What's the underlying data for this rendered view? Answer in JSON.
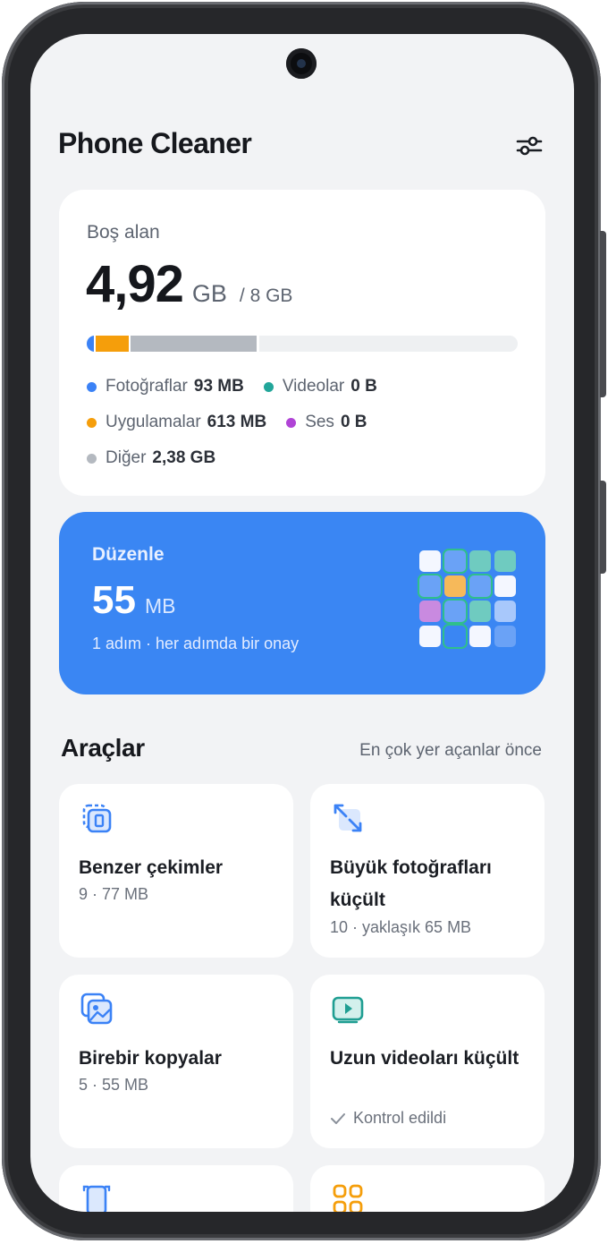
{
  "app": {
    "title": "Phone Cleaner",
    "settings_icon": "sliders-icon"
  },
  "storage": {
    "label": "Boş alan",
    "free_value": "4,92",
    "free_unit": "GB",
    "total": "/ 8 GB",
    "bar_fractions": {
      "photos": 0.012,
      "apps": 0.077,
      "other": 0.298,
      "free": 0.613
    },
    "legend": [
      {
        "label": "Fotoğraflar",
        "value": "93 MB",
        "color": "#3b82f6"
      },
      {
        "label": "Videolar",
        "value": "0 B",
        "color": "#22a69a"
      },
      {
        "label": "Uygulamalar",
        "value": "613 MB",
        "color": "#f59e0b"
      },
      {
        "label": "Ses",
        "value": "0 B",
        "color": "#b044d6"
      },
      {
        "label": "Diğer",
        "value": "2,38 GB",
        "color": "#b4b9c0"
      }
    ]
  },
  "organize": {
    "title": "Düzenle",
    "amount": "55",
    "unit": "MB",
    "subtitle": "1 adım · her adımda bir onay"
  },
  "tools": {
    "title": "Araçlar",
    "sort_label": "En çok yer açanlar önce",
    "items": [
      {
        "name": "Benzer çekimler",
        "meta": "9 · 77 MB",
        "icon": "similar-photos-icon"
      },
      {
        "name": "Büyük fotoğrafları küçült",
        "meta": "10 · yaklaşık 65 MB",
        "icon": "compress-arrows-icon"
      },
      {
        "name": "Birebir kopyalar",
        "meta": "5 · 55 MB",
        "icon": "duplicate-images-icon"
      },
      {
        "name": "Uzun videoları küçült",
        "meta": "Kontrol edildi",
        "meta_icon": "check-icon",
        "icon": "video-play-icon"
      },
      {
        "name": "",
        "meta": "",
        "icon": "screenshot-icon"
      },
      {
        "name": "",
        "meta": "",
        "icon": "apps-grid-icon"
      }
    ]
  },
  "colors": {
    "accent": "#3a86f3",
    "background": "#f2f3f5",
    "card": "#ffffff"
  }
}
